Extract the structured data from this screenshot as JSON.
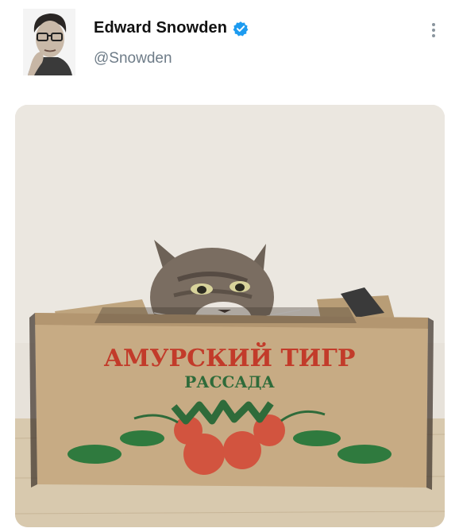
{
  "tweet": {
    "author_name": "Edward Snowden",
    "handle": "@Snowden",
    "verified": true,
    "accent_color": "#1d9bf0"
  },
  "icons": {
    "verified": "verified-badge-icon",
    "more": "more-vertical-icon"
  },
  "media": {
    "box_text_line1": "АМУРСКИЙ ТИГР",
    "box_text_line2": "РАССАДА",
    "box_text_color1": "#c23b2a",
    "box_text_color2": "#2f6b3a"
  }
}
